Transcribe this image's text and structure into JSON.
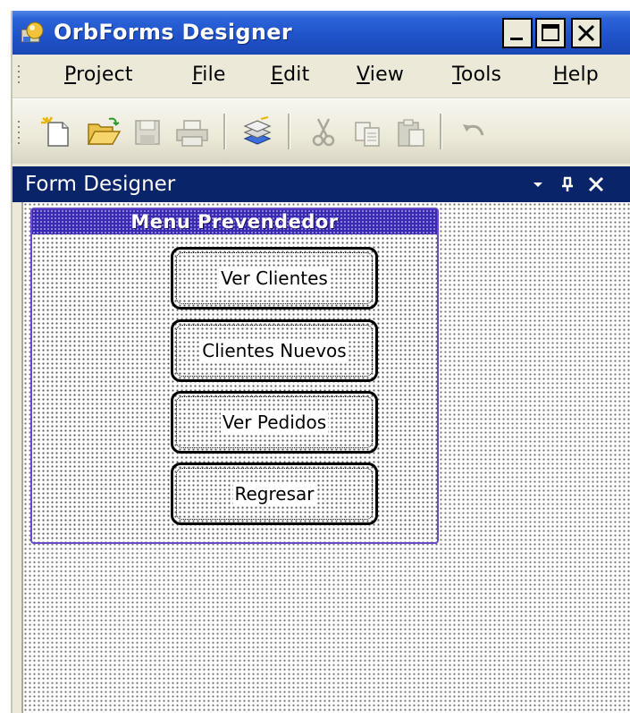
{
  "window": {
    "title": "OrbForms Designer",
    "controls": [
      "minimize",
      "maximize",
      "close"
    ]
  },
  "menubar": {
    "items": [
      {
        "label": "Project",
        "mnemonic": "P"
      },
      {
        "label": "File",
        "mnemonic": "F"
      },
      {
        "label": "Edit",
        "mnemonic": "E"
      },
      {
        "label": "View",
        "mnemonic": "V"
      },
      {
        "label": "Tools",
        "mnemonic": "T"
      },
      {
        "label": "Help",
        "mnemonic": "H"
      }
    ]
  },
  "toolbar": {
    "buttons": [
      {
        "icon": "new-file-icon",
        "enabled": true
      },
      {
        "icon": "open-folder-icon",
        "enabled": true
      },
      {
        "icon": "save-icon",
        "enabled": false
      },
      {
        "icon": "print-icon",
        "enabled": false
      },
      {
        "icon": "layers-icon",
        "enabled": true
      },
      {
        "icon": "cut-icon",
        "enabled": false
      },
      {
        "icon": "copy-icon",
        "enabled": false
      },
      {
        "icon": "paste-icon",
        "enabled": false
      },
      {
        "icon": "undo-icon",
        "enabled": false
      }
    ]
  },
  "panel": {
    "title": "Form Designer",
    "controls": [
      "dropdown",
      "pin",
      "close"
    ]
  },
  "form": {
    "title": "Menu Prevendedor",
    "buttons": [
      {
        "label": "Ver Clientes"
      },
      {
        "label": "Clientes Nuevos"
      },
      {
        "label": "Ver Pedidos"
      },
      {
        "label": "Regresar"
      }
    ]
  },
  "colors": {
    "titlebar": "#2b63d9",
    "panel_header": "#0a246a",
    "form_title": "#3a2ab0",
    "chrome": "#ece9d8"
  }
}
